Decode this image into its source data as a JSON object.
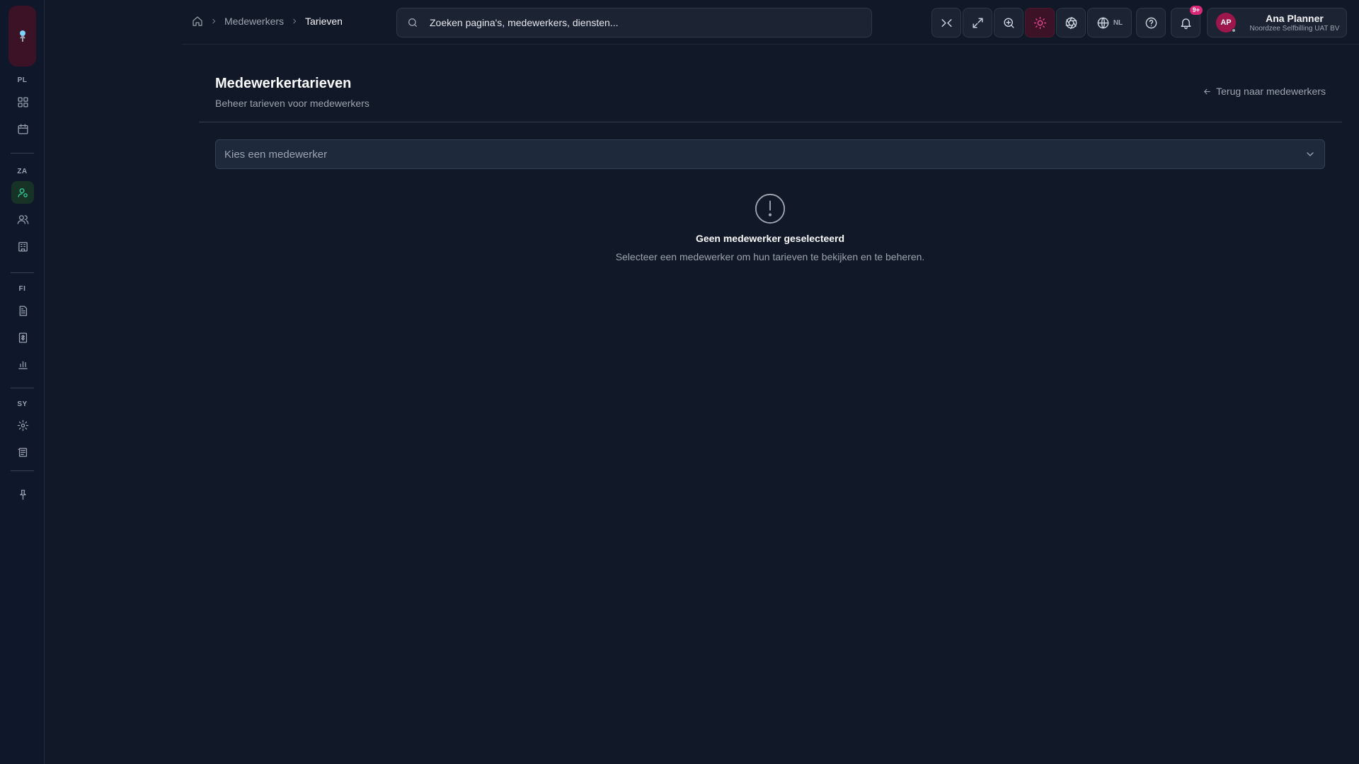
{
  "sidebar": {
    "sections": [
      {
        "label": "PL"
      },
      {
        "label": "ZA"
      },
      {
        "label": "FI"
      },
      {
        "label": "SY"
      }
    ]
  },
  "breadcrumb": {
    "items": [
      "Medewerkers",
      "Tarieven"
    ]
  },
  "search": {
    "placeholder": "Zoeken pagina's, medewerkers, diensten..."
  },
  "toolbar": {
    "language": "NL",
    "notification_badge": "9+"
  },
  "user": {
    "initials": "AP",
    "name": "Ana Planner",
    "organization": "Noordzee Selfbilling UAT BV"
  },
  "page": {
    "title": "Medewerkertarieven",
    "subtitle": "Beheer tarieven voor medewerkers",
    "back_label": "Terug naar medewerkers"
  },
  "employee_select": {
    "placeholder": "Kies een medewerker"
  },
  "empty_state": {
    "title": "Geen medewerker geselecteerd",
    "message": "Selecteer een medewerker om hun tarieven te bekijken en te beheren."
  },
  "colors": {
    "background": "#111827",
    "accent_pink": "#ec4899",
    "accent_green": "#34d399"
  }
}
